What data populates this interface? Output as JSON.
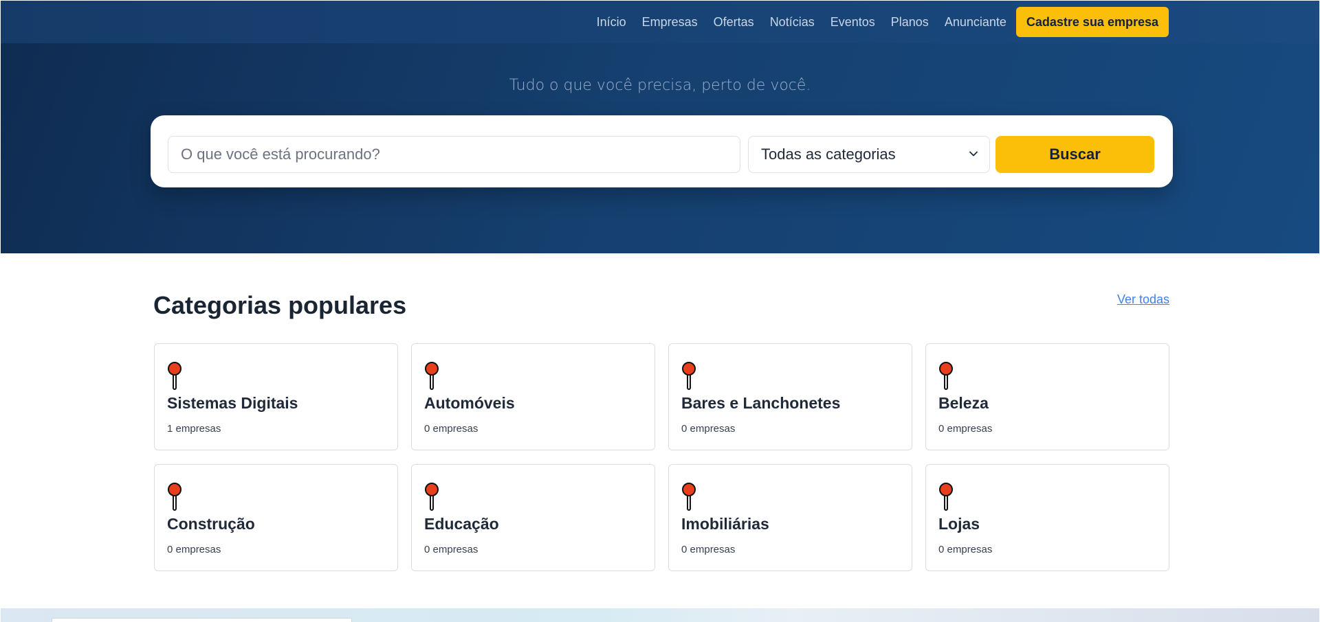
{
  "nav": {
    "items": [
      "Início",
      "Empresas",
      "Ofertas",
      "Notícias",
      "Eventos",
      "Planos",
      "Anunciante"
    ],
    "cta_label": "Cadastre sua empresa"
  },
  "hero": {
    "tagline": "Tudo o que você precisa, perto de você.",
    "search_placeholder": "O que você está procurando?",
    "category_select": "Todas as categorias",
    "search_button": "Buscar"
  },
  "categories": {
    "title": "Categorias populares",
    "see_all": "Ver todas",
    "items": [
      {
        "name": "Sistemas Digitais",
        "count": "1 empresas"
      },
      {
        "name": "Automóveis",
        "count": "0 empresas"
      },
      {
        "name": "Bares e Lanchonetes",
        "count": "0 empresas"
      },
      {
        "name": "Beleza",
        "count": "0 empresas"
      },
      {
        "name": "Construção",
        "count": "0 empresas"
      },
      {
        "name": "Educação",
        "count": "0 empresas"
      },
      {
        "name": "Imobiliárias",
        "count": "0 empresas"
      },
      {
        "name": "Lojas",
        "count": "0 empresas"
      }
    ],
    "icon": "pushpin-icon"
  },
  "colors": {
    "accent": "#fbbf0a",
    "header": "#163b69",
    "link": "#3b82f6",
    "pin": "#e8401c"
  }
}
